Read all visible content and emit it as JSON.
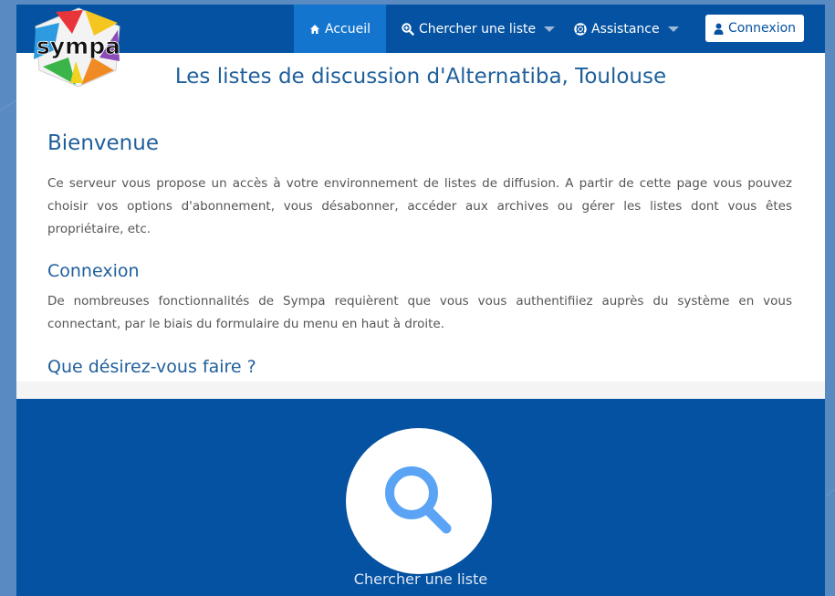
{
  "logo": {
    "text": "sympa"
  },
  "nav": {
    "home": "Accueil",
    "search": "Chercher une liste",
    "help": "Assistance",
    "login": "Connexion"
  },
  "page": {
    "title": "Les listes de discussion d'Alternatiba, Toulouse",
    "welcome_heading": "Bienvenue",
    "welcome_text": "Ce serveur vous propose un accès à votre environnement de listes de diffusion. A partir de cette page vous pouvez choisir vos options d'abonnement, vous désabonner, accéder aux archives ou gérer les listes dont vous êtes propriétaire, etc.",
    "login_heading": "Connexion",
    "login_text": "De nombreuses fonctionnalités de Sympa requièrent que vous vous authentifiiez auprès du système en vous connectant, par le biais du formulaire du menu en haut à droite.",
    "what_heading": "Que désirez-vous faire ?"
  },
  "actions": {
    "search_label": "Chercher une liste"
  },
  "colors": {
    "primary": "#0452a1",
    "active_tab": "#1475cf",
    "heading": "#1f5f9c",
    "search_icon": "#5ba4f5"
  }
}
